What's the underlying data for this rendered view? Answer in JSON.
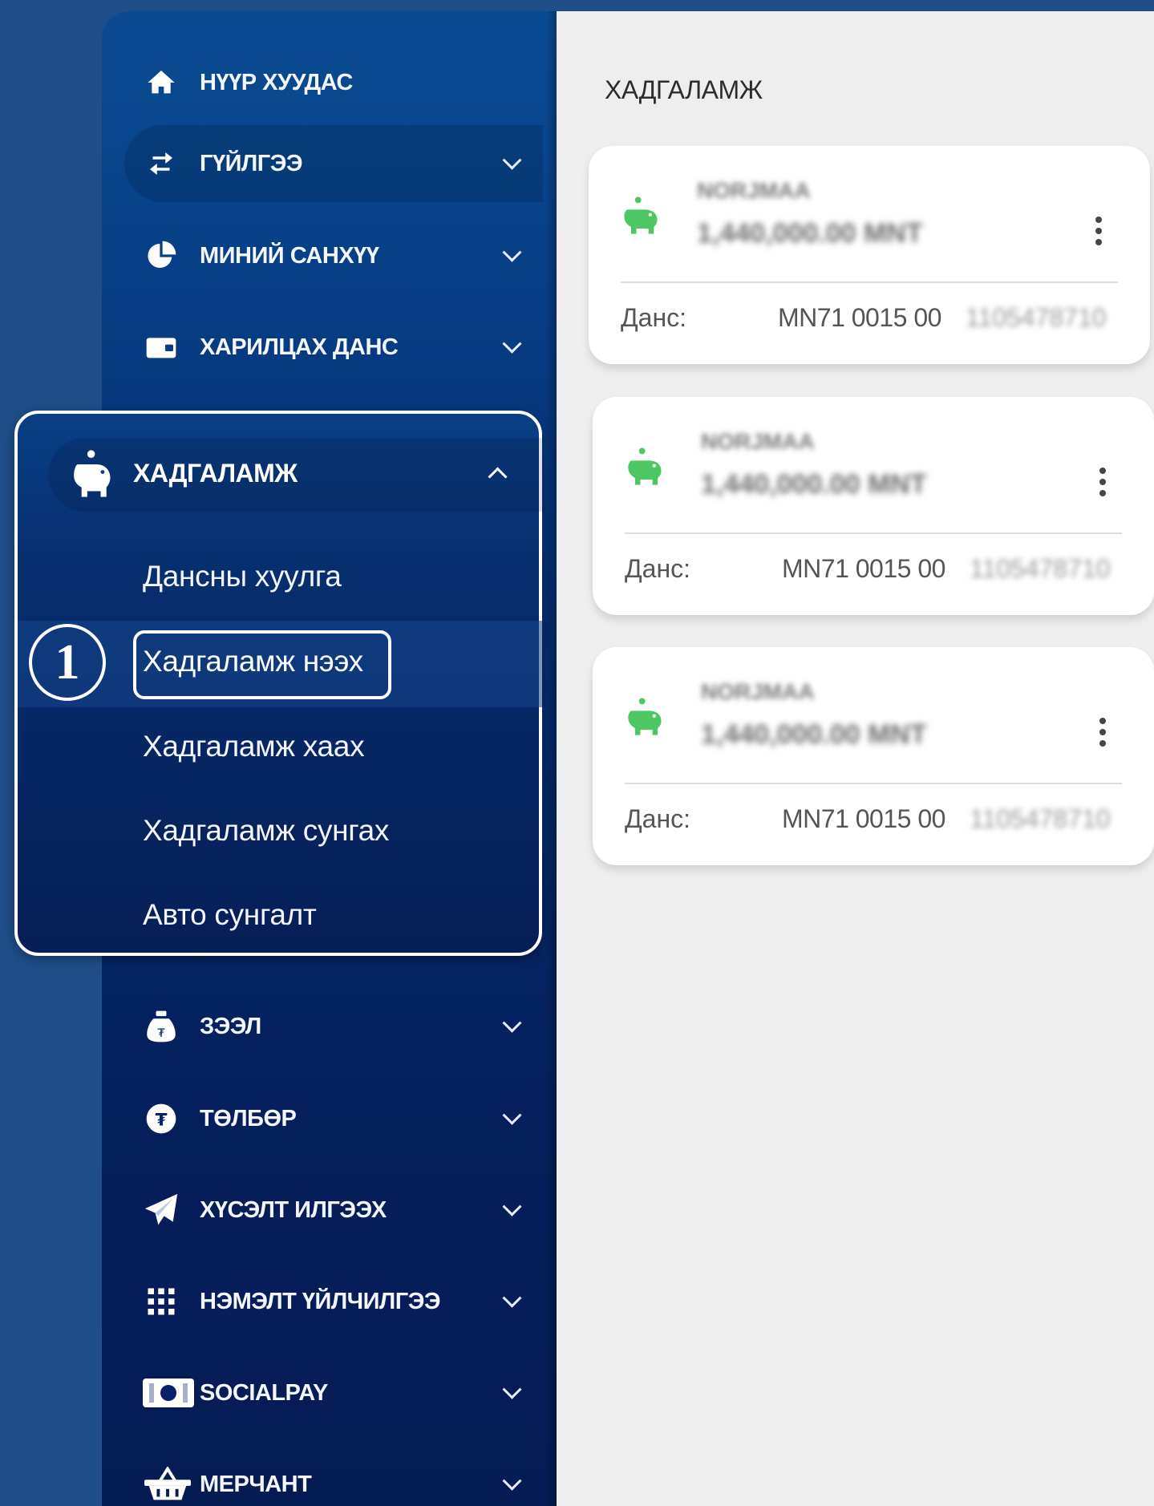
{
  "sidebar": {
    "items": [
      {
        "label": "НҮҮР ХУУДАС",
        "icon": "home-icon",
        "chevron": false
      },
      {
        "label": "ГҮЙЛГЭЭ",
        "icon": "transfer-arrows-icon",
        "chevron": true
      },
      {
        "label": "МИНИЙ САНХҮҮ",
        "icon": "pie-chart-icon",
        "chevron": true
      },
      {
        "label": "ХАРИЛЦАХ ДАНС",
        "icon": "wallet-icon",
        "chevron": true
      },
      {
        "label": "ЗЭЭЛ",
        "icon": "money-bag-icon",
        "chevron": true
      },
      {
        "label": "ТӨЛБӨР",
        "icon": "tugrik-coin-icon",
        "chevron": true
      },
      {
        "label": "ХҮСЭЛТ ИЛГЭЭХ",
        "icon": "paper-plane-icon",
        "chevron": true
      },
      {
        "label": "НЭМЭЛТ ҮЙЛЧИЛГЭЭ",
        "icon": "grid-icon",
        "chevron": true
      },
      {
        "label": "SOCIALPAY",
        "icon": "cash-icon",
        "chevron": true
      },
      {
        "label": "МЕРЧАНТ",
        "icon": "basket-icon",
        "chevron": true
      }
    ],
    "savings_menu": {
      "title": "ХАДГАЛАМЖ",
      "icon": "piggy-bank-icon",
      "sub_items": [
        {
          "label": "Дансны хуулга"
        },
        {
          "label": "Хадгаламж нээх"
        },
        {
          "label": "Хадгаламж хаах"
        },
        {
          "label": "Хадгаламж сунгах"
        },
        {
          "label": "Авто сунгалт"
        }
      ],
      "step_marker": "1"
    }
  },
  "main": {
    "header": "ХАДГАЛАМЖ",
    "cards": [
      {
        "name": "NORJMAA",
        "amount": "1,440,000.00 MNT",
        "account_label": "Данс:",
        "account_prefix": "MN71 0015 00",
        "account_rest": "1105478710"
      },
      {
        "name": "NORJMAA",
        "amount": "1,440,000.00 MNT",
        "account_label": "Данс:",
        "account_prefix": "MN71 0015 00",
        "account_rest": "1105478710"
      },
      {
        "name": "NORJMAA",
        "amount": "1,440,000.00 MNT",
        "account_label": "Данс:",
        "account_prefix": "MN71 0015 00",
        "account_rest": "1105478710"
      }
    ]
  },
  "colors": {
    "background": "#1f4e89",
    "sidebar_top": "#0a4b93",
    "sidebar_bottom": "#051b54",
    "main_bg": "#eeeeee",
    "piggy_green": "#4cc764"
  }
}
